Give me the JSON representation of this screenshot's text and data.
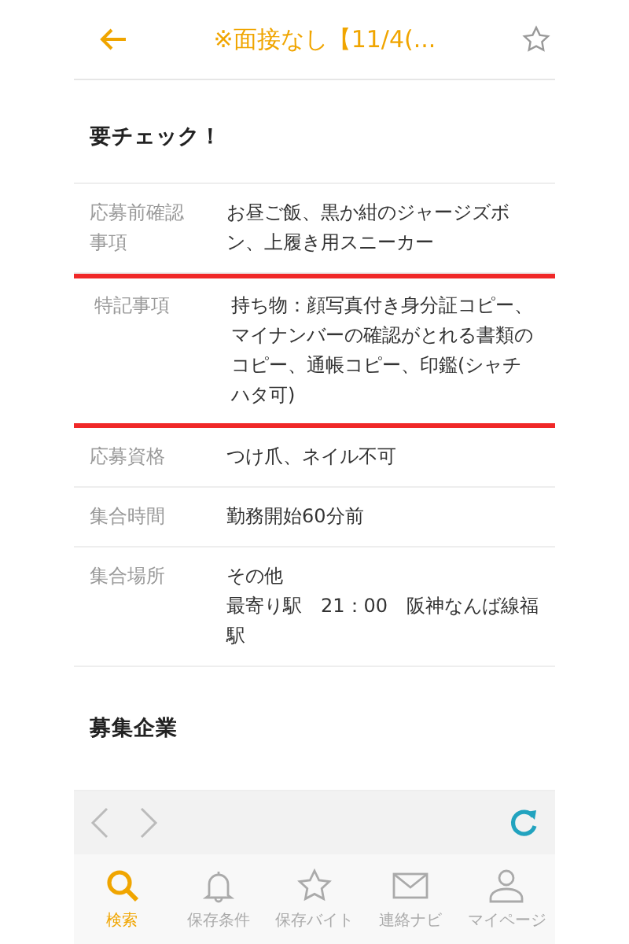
{
  "header": {
    "title": "※面接なし【11/4(..."
  },
  "section_title": "要チェック！",
  "rows": [
    {
      "label": "応募前確認事項",
      "lines": [
        "お昼ご飯、黒か紺のジャージズボン、上履き用スニーカー"
      ],
      "highlighted": false
    },
    {
      "label": "特記事項",
      "lines": [
        "持ち物：顔写真付き身分証コピー、マイナンバーの確認がとれる書類のコピー、通帳コピー、印鑑(シャチハタ可)"
      ],
      "highlighted": true
    },
    {
      "label": "応募資格",
      "lines": [
        "つけ爪、ネイル不可"
      ],
      "highlighted": false
    },
    {
      "label": "集合時間",
      "lines": [
        "勤務開始60分前"
      ],
      "highlighted": false
    },
    {
      "label": "集合場所",
      "lines": [
        "その他",
        "最寄り駅　21：00　阪神なんば線福駅"
      ],
      "highlighted": false
    }
  ],
  "company_section_title": "募集企業",
  "tabs": [
    {
      "label": "検索",
      "selected": true
    },
    {
      "label": "保存条件",
      "selected": false
    },
    {
      "label": "保存バイト",
      "selected": false
    },
    {
      "label": "連絡ナビ",
      "selected": false
    },
    {
      "label": "マイページ",
      "selected": false
    }
  ]
}
